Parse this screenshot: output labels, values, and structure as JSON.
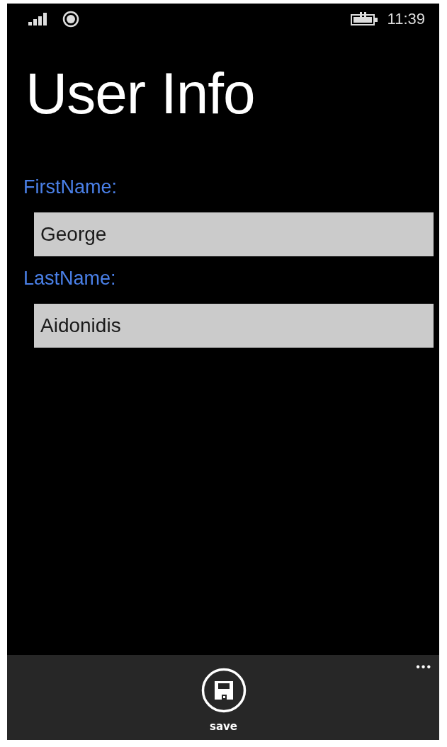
{
  "status_bar": {
    "time": "11:39"
  },
  "page": {
    "title": "User Info"
  },
  "fields": [
    {
      "label": "FirstName:",
      "value": "George"
    },
    {
      "label": "LastName:",
      "value": "Aidonidis"
    }
  ],
  "app_bar": {
    "buttons": [
      {
        "label": "save"
      }
    ],
    "more": "•••"
  }
}
